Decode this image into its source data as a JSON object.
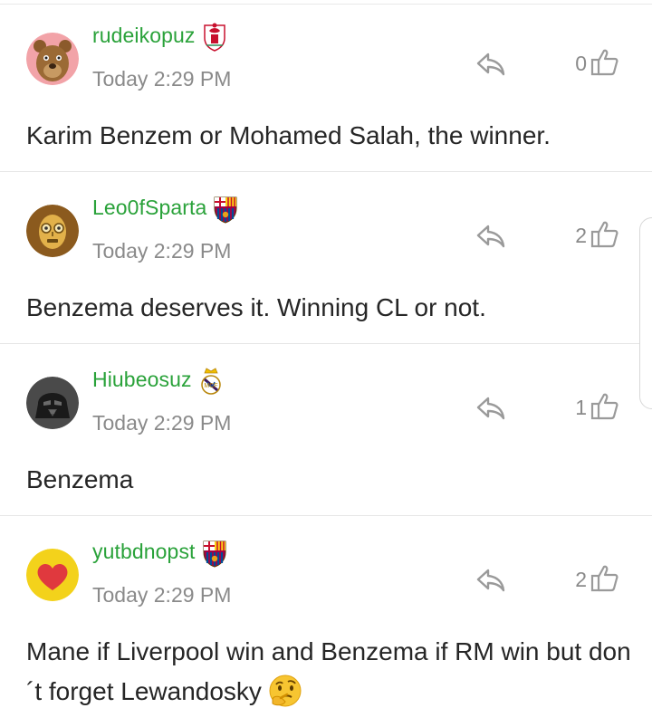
{
  "comments": [
    {
      "username": "rudeikopuz",
      "club": "Liverpool",
      "avatar": "bear-avatar",
      "timestamp": "Today 2:29 PM",
      "likes": "0",
      "text": "Karim Benzem or Mohamed Salah, the winner."
    },
    {
      "username": "Leo0fSparta",
      "club": "Barcelona",
      "avatar": "robot-avatar",
      "timestamp": "Today 2:29 PM",
      "likes": "2",
      "text": "Benzema deserves it. Winning CL or not."
    },
    {
      "username": "Hiubeosuz",
      "club": "Real Madrid",
      "avatar": "dark-helmet-avatar",
      "timestamp": "Today 2:29 PM",
      "likes": "1",
      "text": "Benzema"
    },
    {
      "username": "yutbdnopst",
      "club": "Barcelona",
      "avatar": "heart-avatar",
      "timestamp": "Today 2:29 PM",
      "likes": "2",
      "text": "Mane if Liverpool win and Benzema if RM win but don´t forget Lewandosky",
      "emoji": "thinking-face"
    }
  ],
  "colors": {
    "username": "#2aa23a",
    "muted": "#8a8a8a",
    "text": "#262626",
    "divider": "#e6e6e6"
  },
  "icons": {
    "reply": "reply-arrow-icon",
    "like": "thumbs-up-icon"
  }
}
